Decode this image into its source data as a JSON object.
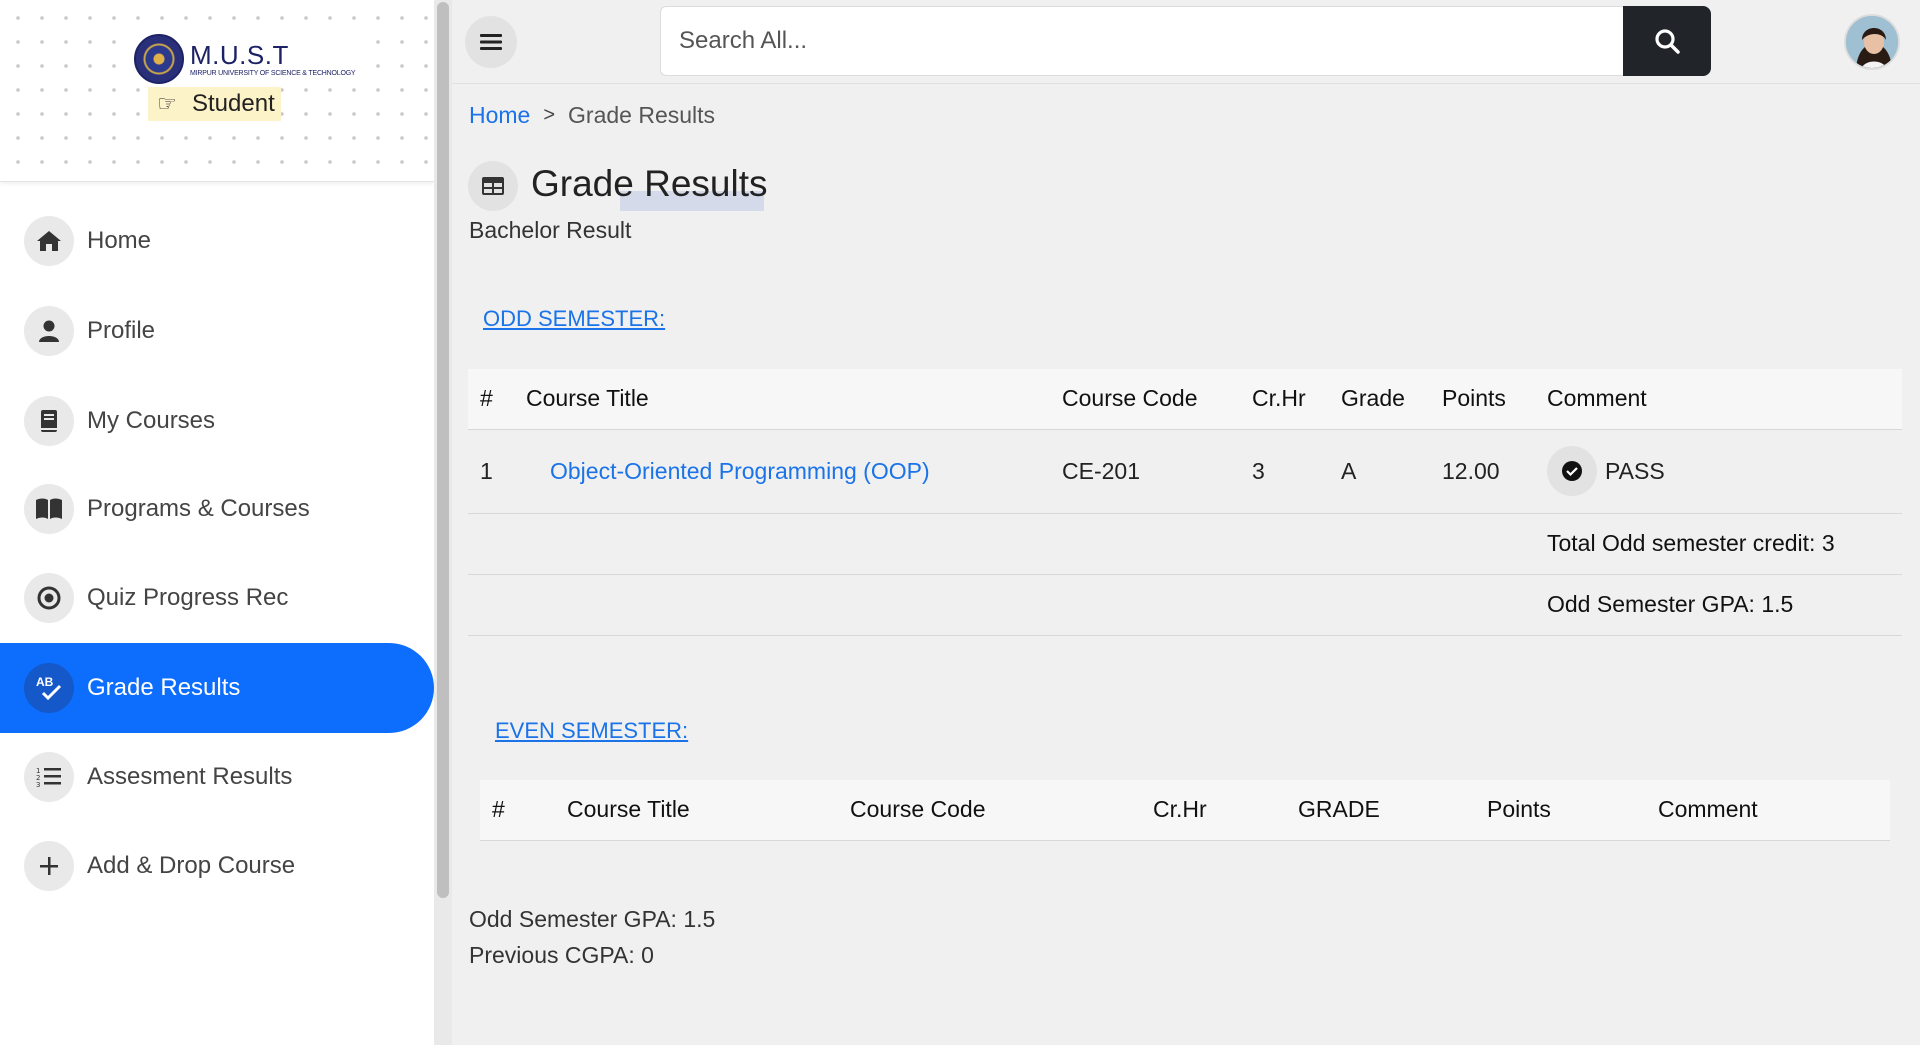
{
  "brand": {
    "name": "M.U.S.T",
    "subtitle": "MIRPUR UNIVERSITY OF SCIENCE & TECHNOLOGY",
    "role": "Student",
    "colors": {
      "primary": "#0d6efd",
      "link": "#1a73e8",
      "dark": "#212529",
      "badge": "#fdf3c8"
    }
  },
  "sidebar": {
    "items": [
      {
        "label": "Home",
        "icon": "home-icon"
      },
      {
        "label": "Profile",
        "icon": "user-icon"
      },
      {
        "label": "My Courses",
        "icon": "book-icon"
      },
      {
        "label": "Programs & Courses",
        "icon": "open-book-icon"
      },
      {
        "label": "Quiz Progress Rec",
        "icon": "target-icon"
      },
      {
        "label": "Grade Results",
        "icon": "grade-icon",
        "active": true
      },
      {
        "label": "Assesment Results",
        "icon": "list-icon"
      },
      {
        "label": "Add & Drop Course",
        "icon": "plus-icon"
      }
    ]
  },
  "topbar": {
    "search_placeholder": "Search All..."
  },
  "breadcrumb": {
    "home": "Home",
    "separator": ">",
    "current": "Grade Results"
  },
  "page": {
    "title": "Grade Results",
    "subtitle": "Bachelor Result"
  },
  "odd_semester": {
    "heading": "ODD SEMESTER:",
    "columns": [
      "#",
      "Course Title",
      "Course Code",
      "Cr.Hr",
      "Grade",
      "Points",
      "Comment"
    ],
    "rows": [
      {
        "num": "1",
        "title": "Object-Oriented Programming (OOP)",
        "code": "CE-201",
        "crhr": "3",
        "grade": "A",
        "points": "12.00",
        "comment": "PASS"
      }
    ],
    "total_credit": "Total Odd semester credit: 3",
    "gpa": "Odd Semester GPA: 1.5"
  },
  "even_semester": {
    "heading": "EVEN SEMESTER:",
    "columns": [
      "#",
      "Course Title",
      "Course Code",
      "Cr.Hr",
      "GRADE",
      "Points",
      "Comment"
    ]
  },
  "summary": {
    "gpa": "Odd Semester GPA: 1.5",
    "cgpa": "Previous CGPA: 0"
  }
}
